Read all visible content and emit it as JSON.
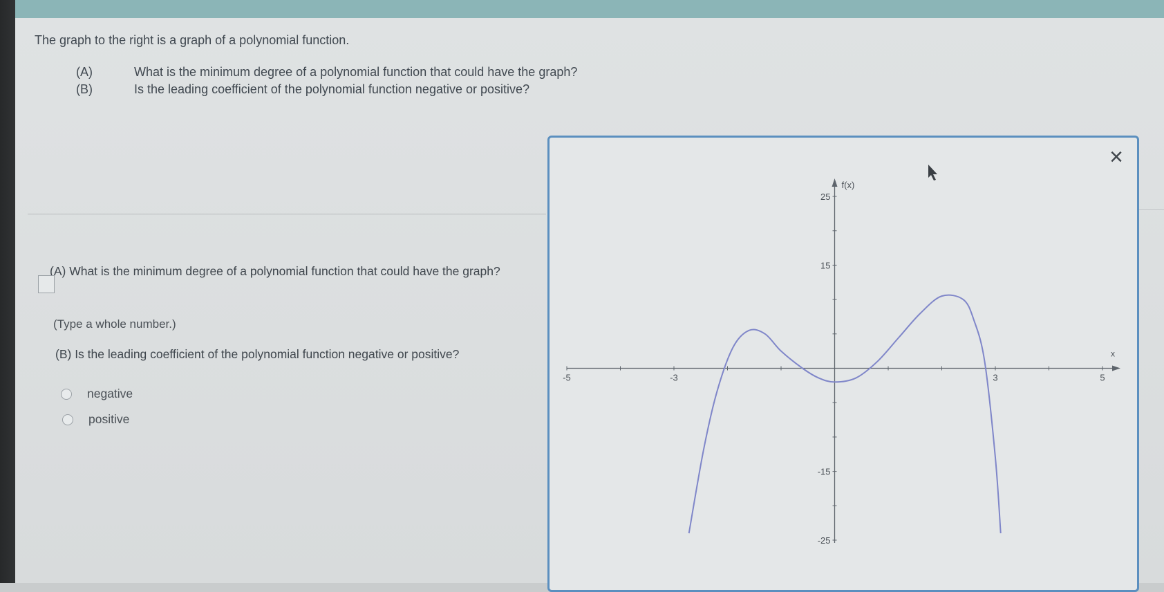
{
  "intro": "The graph to the right is a graph of a polynomial function.",
  "questions": [
    {
      "tag": "(A)",
      "text": "What is the minimum degree of a polynomial function that could have the graph?"
    },
    {
      "tag": "(B)",
      "text": "Is the leading coefficient of the polynomial function negative or positive?"
    }
  ],
  "part_a": {
    "question": "(A) What is the minimum degree of a polynomial function that could have the graph?",
    "answer_value": "",
    "hint": "(Type a whole number.)"
  },
  "part_b": {
    "question": "(B) Is the leading coefficient of the polynomial function negative or positive?",
    "options": [
      "negative",
      "positive"
    ]
  },
  "graph_panel": {
    "close_icon": "close-icon"
  },
  "colors": {
    "curve": "#7f86c9",
    "panel_border": "#5b8fbf",
    "top_bar": "#8bb5b7"
  },
  "chart_data": {
    "type": "line",
    "xlabel": "x",
    "ylabel": "f(x)",
    "xlim": [
      -5,
      5
    ],
    "ylim": [
      -25,
      25
    ],
    "x_ticks": [
      -5,
      -3,
      3,
      5
    ],
    "y_ticks": [
      25,
      15,
      -15,
      -25
    ],
    "series": [
      {
        "x": [
          -2.72,
          -2.45,
          -2.2,
          -1.9,
          -1.6,
          -1.3,
          -1.0,
          -0.6,
          -0.3,
          0.0,
          0.4,
          0.8,
          1.2,
          1.6,
          2.0,
          2.4,
          2.6,
          2.8,
          3.0,
          3.1
        ],
        "y": [
          -24.0,
          -12.0,
          -3.5,
          3.0,
          5.5,
          5.0,
          2.5,
          0.0,
          -1.4,
          -2.0,
          -1.4,
          1.0,
          4.5,
          8.0,
          10.5,
          10.0,
          7.0,
          1.0,
          -13.0,
          -24.0
        ]
      }
    ]
  }
}
